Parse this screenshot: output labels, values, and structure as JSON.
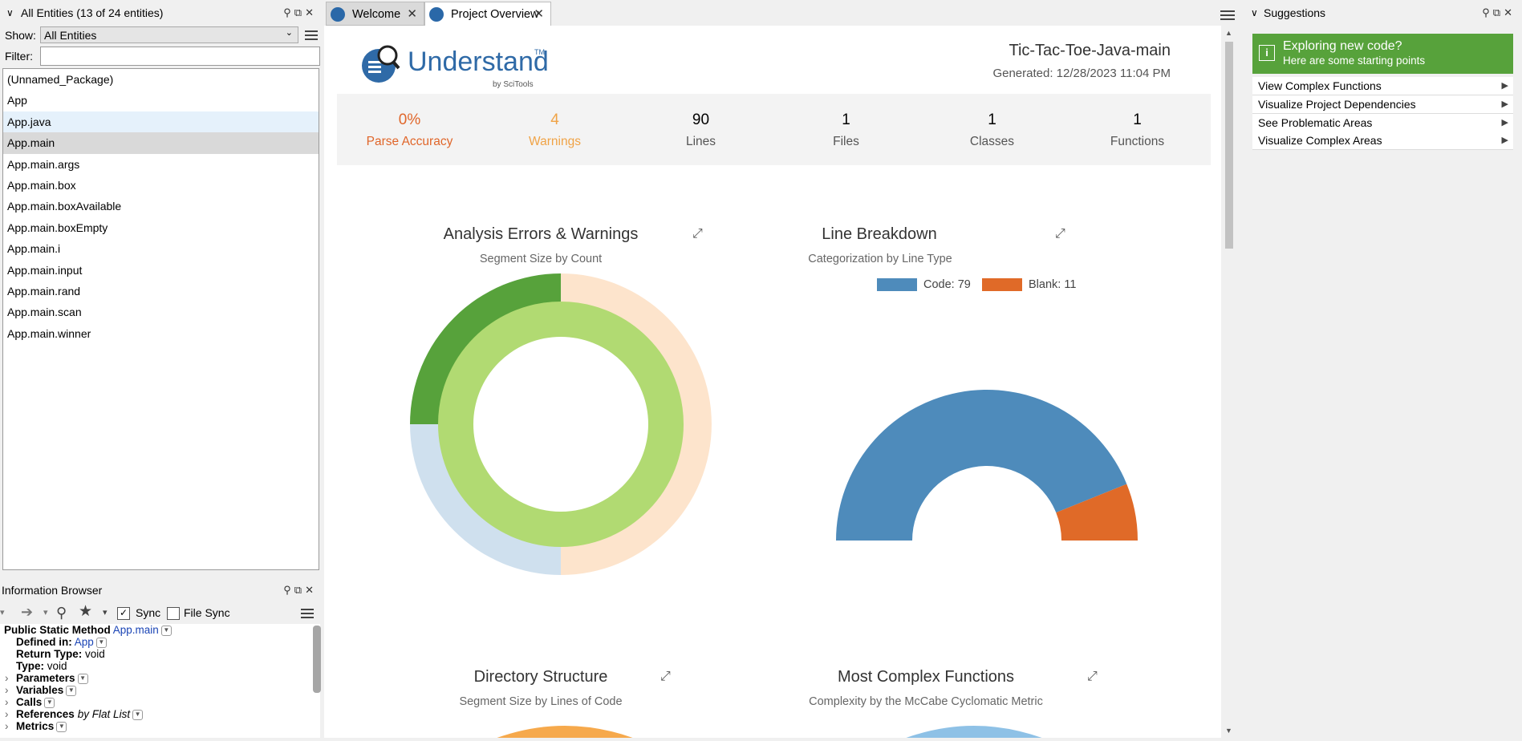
{
  "left_panel": {
    "title": "All Entities (13 of 24 entities)",
    "show_label": "Show:",
    "show_value": "All Entities",
    "filter_label": "Filter:",
    "filter_value": "",
    "entities": [
      "(Unnamed_Package)",
      "App",
      "App.java",
      "App.main",
      "App.main.args",
      "App.main.box",
      "App.main.boxAvailable",
      "App.main.boxEmpty",
      "App.main.i",
      "App.main.input",
      "App.main.rand",
      "App.main.scan",
      "App.main.winner"
    ],
    "hovered_index": 2,
    "selected_index": 3
  },
  "info_browser": {
    "title": "Information Browser",
    "sync_label": "Sync",
    "sync_checked": true,
    "file_sync_label": "File Sync",
    "file_sync_checked": false,
    "header_kind": "Public Static Method",
    "header_name": "App.main",
    "defined_in_label": "Defined in:",
    "defined_in_value": "App",
    "return_type_label": "Return Type:",
    "return_type_value": "void",
    "type_label": "Type:",
    "type_value": "void",
    "sections": [
      "Parameters",
      "Variables",
      "Calls",
      "References",
      "Metrics"
    ],
    "references_suffix": "by Flat List"
  },
  "tabs": [
    {
      "label": "Welcome",
      "active": false
    },
    {
      "label": "Project Overview",
      "active": true
    }
  ],
  "overview": {
    "logo_text": "Understand",
    "logo_tm": "TM",
    "logo_by": "by SciTools",
    "project_name": "Tic-Tac-Toe-Java-main",
    "generated": "Generated: 12/28/2023 11:04 PM",
    "stats": [
      {
        "value": "0%",
        "label": "Parse Accuracy",
        "color": "#e0662a"
      },
      {
        "value": "4",
        "label": "Warnings",
        "color": "#f0a346"
      },
      {
        "value": "90",
        "label": "Lines",
        "color": "#333333"
      },
      {
        "value": "1",
        "label": "Files",
        "color": "#333333"
      },
      {
        "value": "1",
        "label": "Classes",
        "color": "#333333"
      },
      {
        "value": "1",
        "label": "Functions",
        "color": "#333333"
      }
    ],
    "analysis_title": "Analysis Errors & Warnings",
    "analysis_subtitle": "Segment Size by Count",
    "line_title": "Line Breakdown",
    "line_subtitle": "Categorization by Line Type",
    "dir_title": "Directory Structure",
    "dir_subtitle": "Segment Size by Lines of Code",
    "complex_title": "Most Complex Functions",
    "complex_subtitle": "Complexity by the McCabe Cyclomatic Metric"
  },
  "chart_data": [
    {
      "type": "pie",
      "title": "Line Breakdown",
      "subtitle": "Categorization by Line Type",
      "series": [
        {
          "name": "Code",
          "value": 79,
          "color": "#4e8bbb"
        },
        {
          "name": "Blank",
          "value": 11,
          "color": "#e06a28"
        }
      ],
      "legend_labels": [
        "Code: 79",
        "Blank: 11"
      ],
      "legend": "top"
    }
  ],
  "suggestions": {
    "title": "Suggestions",
    "banner_line1": "Exploring new code?",
    "banner_line2": "Here are some starting points",
    "items": [
      "View Complex Functions",
      "Visualize Project Dependencies",
      "See Problematic Areas",
      "Visualize Complex Areas"
    ]
  },
  "colors": {
    "accent_green": "#57a23b",
    "parse_accuracy": "#e0662a",
    "warnings": "#f0a346",
    "code": "#4e8bbb",
    "blank": "#e06a28"
  }
}
